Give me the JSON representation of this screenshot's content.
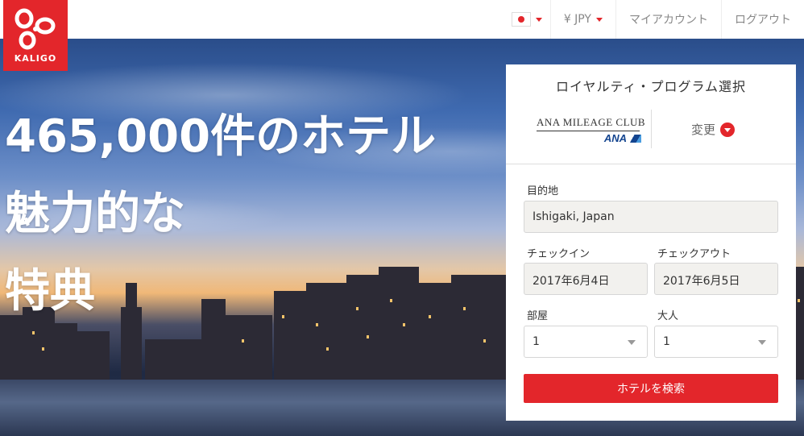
{
  "brand": {
    "name": "KALIGO",
    "color": "#e3262b"
  },
  "nav": {
    "language_icon": "japan-flag-icon",
    "currency": "¥ JPY",
    "my_account": "マイアカウント",
    "logout": "ログアウト"
  },
  "hero": {
    "line1": "465,000件のホテル",
    "line2": "魅力的な",
    "line3": "特典"
  },
  "panel": {
    "title": "ロイヤルティ・プログラム選択",
    "program_logo_text": "ANA MILEAGE CLUB",
    "program_logo_mark": "ANA",
    "change_label": "変更",
    "destination_label": "目的地",
    "destination_value": "Ishigaki, Japan",
    "checkin_label": "チェックイン",
    "checkin_value": "2017年6月4日",
    "checkout_label": "チェックアウト",
    "checkout_value": "2017年6月5日",
    "rooms_label": "部屋",
    "rooms_value": "1",
    "adults_label": "大人",
    "adults_value": "1",
    "search_label": "ホテルを検索"
  }
}
